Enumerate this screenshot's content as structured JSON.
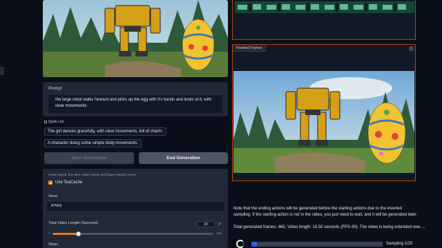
{
  "prompt": {
    "label": "Prompt",
    "text": "the large  robot walks forward and picks up the egg with it's hands and looks at it, with clear movements"
  },
  "quick_list": {
    "label": "Quick List",
    "items": [
      "The girl dances gracefully, with clear movements, full of charm.",
      "A character doing some simple body movements."
    ]
  },
  "buttons": {
    "start": "Start Generation",
    "end": "End Generation"
  },
  "settings": {
    "hint": "Faster speed, but often makes hands and fingers slightly worse.",
    "teacache_label": "Use TeaCache",
    "teacache_checked": true,
    "seed_label": "Seed",
    "seed_value": "87569",
    "length_label": "Total Video Length (Seconds)",
    "length_value": "20",
    "length_min": "1",
    "length_max": "120",
    "steps_label": "Steps"
  },
  "finished_frames": {
    "tab_label": "Finished Frames"
  },
  "output": {
    "note": "Note that the ending actions will be generated before the starting actions due to the inverted sampling. If the starting action is not in the video, you just need to wait, and it will be generated later.",
    "total": "Total generated frames: 465, Video length: 15.50 seconds (FPS-30). The video is being extended now ...",
    "progress_label": "Sampling 1/25",
    "progress_fraction": 0.04
  },
  "colors": {
    "accent": "#f97316",
    "progress": "#2563eb",
    "panel_border": "#c2410c"
  }
}
